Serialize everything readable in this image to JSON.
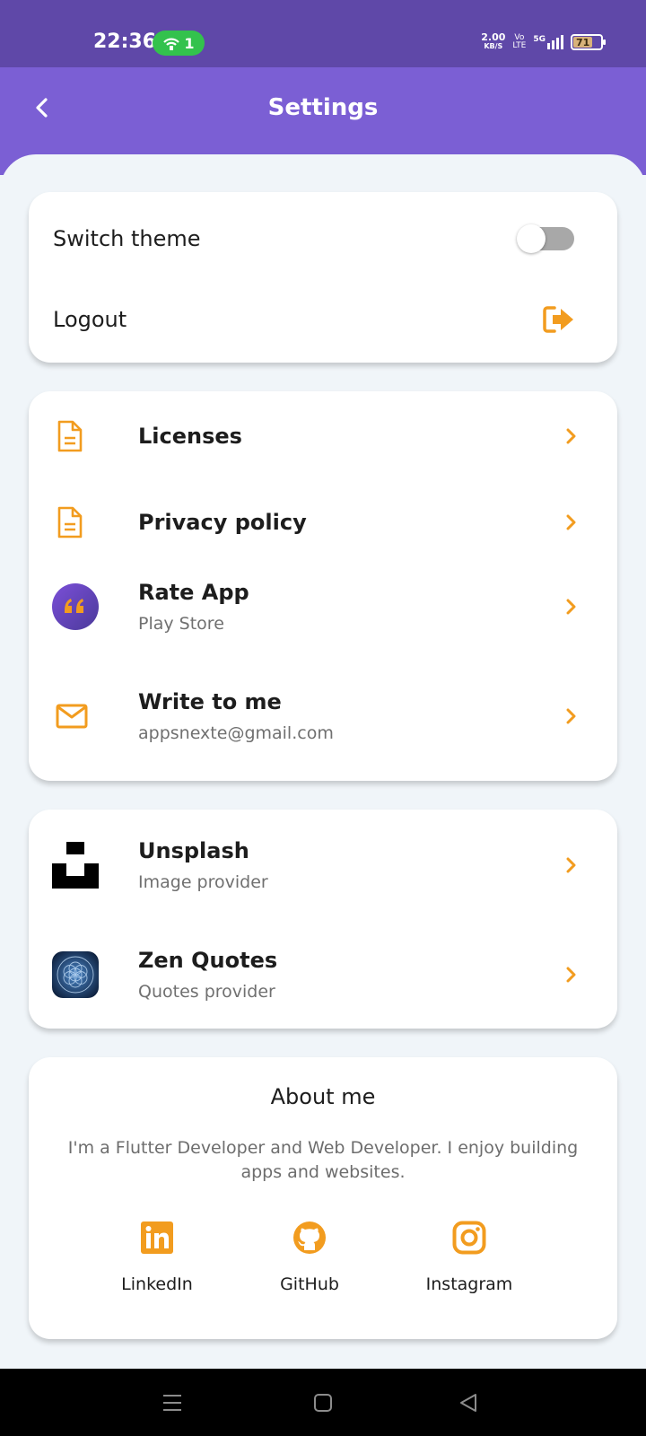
{
  "status": {
    "time": "22:36",
    "hotspot_count": "1",
    "net_speed": "2.00",
    "net_unit": "KB/S",
    "volte": "Vo",
    "lte": "LTE",
    "network": "5G",
    "battery": "71"
  },
  "header": {
    "title": "Settings"
  },
  "prefs": {
    "switch_theme": "Switch theme",
    "theme_on": false,
    "logout": "Logout"
  },
  "links": [
    {
      "title": "Licenses",
      "icon": "document-icon"
    },
    {
      "title": "Privacy policy",
      "icon": "document-icon"
    },
    {
      "title": "Rate App",
      "subtitle": "Play Store",
      "icon": "quote-icon"
    },
    {
      "title": "Write to me",
      "subtitle": "appsnexte@gmail.com",
      "icon": "mail-icon"
    }
  ],
  "providers": [
    {
      "title": "Unsplash",
      "subtitle": "Image provider",
      "icon": "unsplash-logo"
    },
    {
      "title": "Zen Quotes",
      "subtitle": "Quotes provider",
      "icon": "zen-quotes-logo"
    }
  ],
  "about": {
    "title": "About me",
    "text": "I'm a Flutter Developer and Web Developer. I enjoy building apps and websites.",
    "socials": [
      {
        "label": "LinkedIn",
        "icon": "linkedin-icon"
      },
      {
        "label": "GitHub",
        "icon": "github-icon"
      },
      {
        "label": "Instagram",
        "icon": "instagram-icon"
      }
    ]
  },
  "colors": {
    "accent": "#f29c1f",
    "header": "#7b5fd4",
    "status_bar": "#5f48a8",
    "background": "#f0f5f9"
  }
}
